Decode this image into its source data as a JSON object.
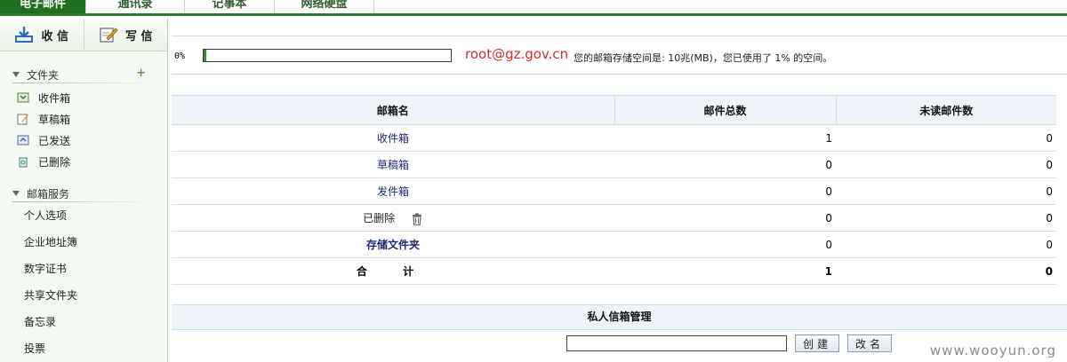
{
  "tabs": [
    "电子邮件",
    "通讯录",
    "记事本",
    "网络硬盘"
  ],
  "actions": {
    "receive": "收 信",
    "write": "写 信"
  },
  "folders": {
    "title": "文件夹",
    "add": "+",
    "items": [
      "收件箱",
      "草稿箱",
      "已发送",
      "已删除"
    ]
  },
  "services": {
    "title": "邮箱服务",
    "items": [
      "个人选项",
      "企业地址簿",
      "数字证书",
      "共享文件夹",
      "备忘录",
      "投票"
    ]
  },
  "quota": {
    "percent_label": "0%",
    "used_fraction": 0.01,
    "email": "root@gz.gov.cn",
    "text": "您的邮箱存储空间是: 10兆(MB)，您已使用了 1% 的空间。"
  },
  "mail_table": {
    "headers": [
      "邮箱名",
      "邮件总数",
      "未读邮件数"
    ],
    "rows": [
      {
        "name": "收件箱",
        "total": "1",
        "unread": "0"
      },
      {
        "name": "草稿箱",
        "total": "0",
        "unread": "0"
      },
      {
        "name": "发件箱",
        "total": "0",
        "unread": "0"
      },
      {
        "name": "已删除",
        "total": "0",
        "unread": "0"
      },
      {
        "name": "存储文件夹",
        "total": "0",
        "unread": "0"
      },
      {
        "name": "合 计",
        "total": "1",
        "unread": "0"
      }
    ]
  },
  "private_mgmt": {
    "title": "私人信箱管理",
    "input_value": "",
    "create": "创建",
    "rename": "改名"
  },
  "watermark": "www.wooyun.org",
  "colors": {
    "accent": "#1f6f1f",
    "email": "#d22d2d",
    "link": "#1c2a7a"
  }
}
